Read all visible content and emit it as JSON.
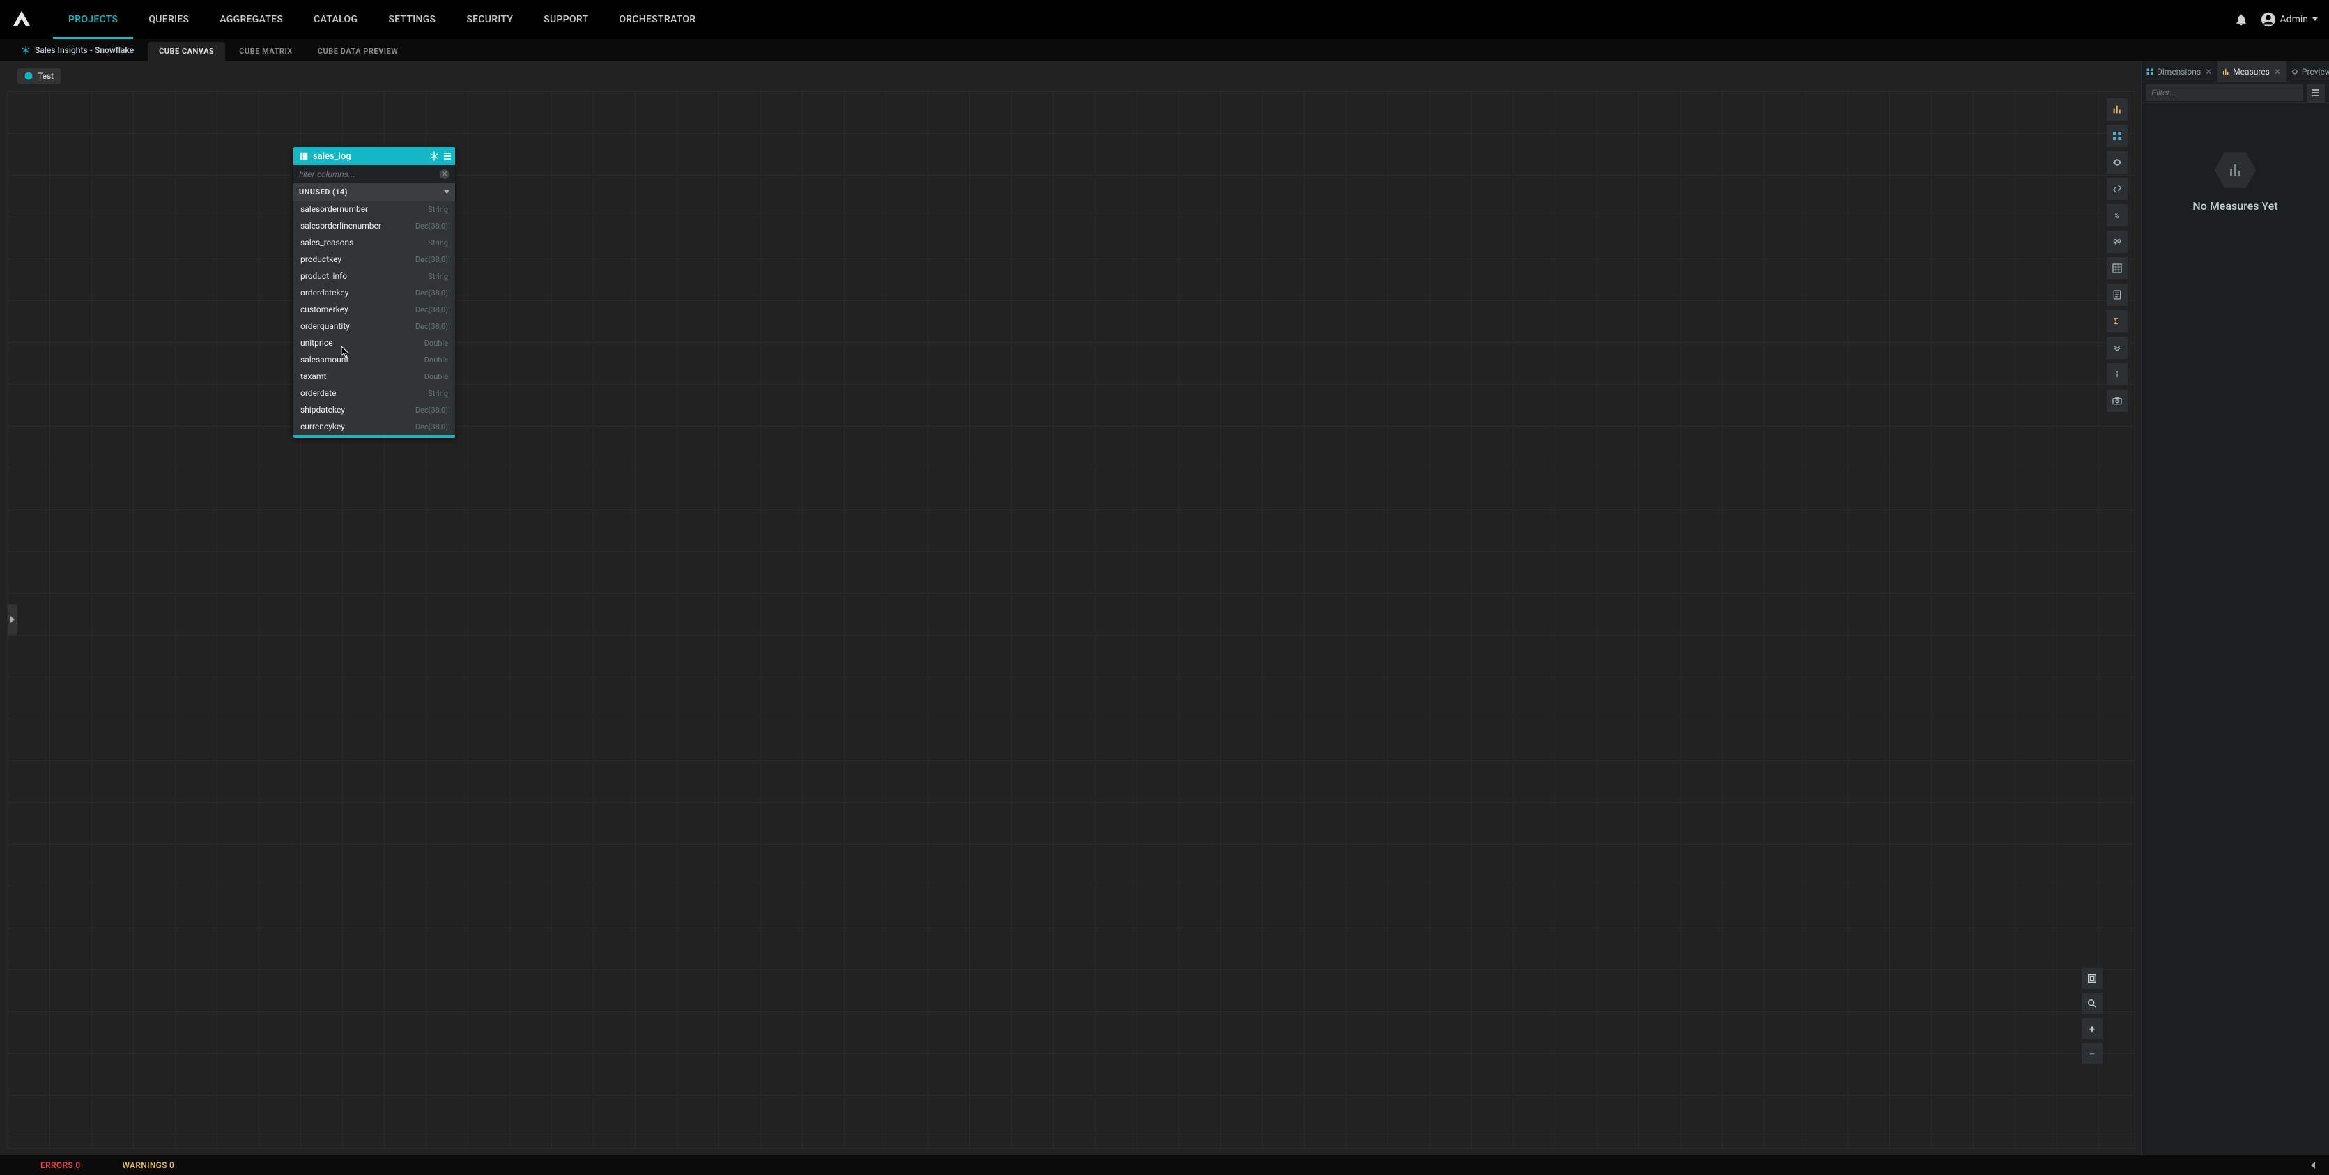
{
  "nav": {
    "items": [
      {
        "label": "PROJECTS",
        "active": true
      },
      {
        "label": "QUERIES",
        "active": false
      },
      {
        "label": "AGGREGATES",
        "active": false
      },
      {
        "label": "CATALOG",
        "active": false
      },
      {
        "label": "SETTINGS",
        "active": false
      },
      {
        "label": "SECURITY",
        "active": false
      },
      {
        "label": "SUPPORT",
        "active": false
      },
      {
        "label": "ORCHESTRATOR",
        "active": false
      }
    ],
    "user": "Admin"
  },
  "breadcrumb": "Sales Insights - Snowflake",
  "secondary_tabs": [
    {
      "label": "CUBE CANVAS",
      "active": true
    },
    {
      "label": "CUBE MATRIX",
      "active": false
    },
    {
      "label": "CUBE DATA PREVIEW",
      "active": false
    }
  ],
  "chip": "Test",
  "table_card": {
    "title": "sales_log",
    "filter_placeholder": "filter columns...",
    "group_label": "UNUSED (14)",
    "columns": [
      {
        "name": "salesordernumber",
        "type": "String"
      },
      {
        "name": "salesorderlinenumber",
        "type": "Dec(38,0)"
      },
      {
        "name": "sales_reasons",
        "type": "String"
      },
      {
        "name": "productkey",
        "type": "Dec(38,0)"
      },
      {
        "name": "product_info",
        "type": "String"
      },
      {
        "name": "orderdatekey",
        "type": "Dec(38,0)"
      },
      {
        "name": "customerkey",
        "type": "Dec(38,0)"
      },
      {
        "name": "orderquantity",
        "type": "Dec(38,0)"
      },
      {
        "name": "unitprice",
        "type": "Double"
      },
      {
        "name": "salesamount",
        "type": "Double"
      },
      {
        "name": "taxamt",
        "type": "Double"
      },
      {
        "name": "orderdate",
        "type": "String"
      },
      {
        "name": "shipdatekey",
        "type": "Dec(38,0)"
      },
      {
        "name": "currencykey",
        "type": "Dec(38,0)"
      }
    ]
  },
  "right_panel": {
    "tabs": [
      {
        "label": "Dimensions",
        "kind": "d",
        "active": false
      },
      {
        "label": "Measures",
        "kind": "m",
        "active": true
      },
      {
        "label": "Preview",
        "kind": "p",
        "active": false
      }
    ],
    "filter_placeholder": "Filter...",
    "empty_text": "No Measures Yet"
  },
  "status": {
    "errors_label": "ERRORS 0",
    "warnings_label": "WARNINGS 0"
  },
  "zoom": {
    "plus": "+",
    "minus": "−"
  }
}
